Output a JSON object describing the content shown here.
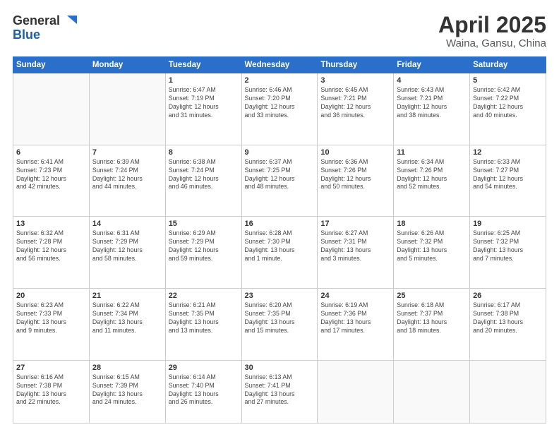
{
  "logo": {
    "general": "General",
    "blue": "Blue"
  },
  "title": {
    "month_year": "April 2025",
    "location": "Waina, Gansu, China"
  },
  "days_of_week": [
    "Sunday",
    "Monday",
    "Tuesday",
    "Wednesday",
    "Thursday",
    "Friday",
    "Saturday"
  ],
  "weeks": [
    [
      {
        "day": "",
        "info": ""
      },
      {
        "day": "",
        "info": ""
      },
      {
        "day": "1",
        "info": "Sunrise: 6:47 AM\nSunset: 7:19 PM\nDaylight: 12 hours\nand 31 minutes."
      },
      {
        "day": "2",
        "info": "Sunrise: 6:46 AM\nSunset: 7:20 PM\nDaylight: 12 hours\nand 33 minutes."
      },
      {
        "day": "3",
        "info": "Sunrise: 6:45 AM\nSunset: 7:21 PM\nDaylight: 12 hours\nand 36 minutes."
      },
      {
        "day": "4",
        "info": "Sunrise: 6:43 AM\nSunset: 7:21 PM\nDaylight: 12 hours\nand 38 minutes."
      },
      {
        "day": "5",
        "info": "Sunrise: 6:42 AM\nSunset: 7:22 PM\nDaylight: 12 hours\nand 40 minutes."
      }
    ],
    [
      {
        "day": "6",
        "info": "Sunrise: 6:41 AM\nSunset: 7:23 PM\nDaylight: 12 hours\nand 42 minutes."
      },
      {
        "day": "7",
        "info": "Sunrise: 6:39 AM\nSunset: 7:24 PM\nDaylight: 12 hours\nand 44 minutes."
      },
      {
        "day": "8",
        "info": "Sunrise: 6:38 AM\nSunset: 7:24 PM\nDaylight: 12 hours\nand 46 minutes."
      },
      {
        "day": "9",
        "info": "Sunrise: 6:37 AM\nSunset: 7:25 PM\nDaylight: 12 hours\nand 48 minutes."
      },
      {
        "day": "10",
        "info": "Sunrise: 6:36 AM\nSunset: 7:26 PM\nDaylight: 12 hours\nand 50 minutes."
      },
      {
        "day": "11",
        "info": "Sunrise: 6:34 AM\nSunset: 7:26 PM\nDaylight: 12 hours\nand 52 minutes."
      },
      {
        "day": "12",
        "info": "Sunrise: 6:33 AM\nSunset: 7:27 PM\nDaylight: 12 hours\nand 54 minutes."
      }
    ],
    [
      {
        "day": "13",
        "info": "Sunrise: 6:32 AM\nSunset: 7:28 PM\nDaylight: 12 hours\nand 56 minutes."
      },
      {
        "day": "14",
        "info": "Sunrise: 6:31 AM\nSunset: 7:29 PM\nDaylight: 12 hours\nand 58 minutes."
      },
      {
        "day": "15",
        "info": "Sunrise: 6:29 AM\nSunset: 7:29 PM\nDaylight: 12 hours\nand 59 minutes."
      },
      {
        "day": "16",
        "info": "Sunrise: 6:28 AM\nSunset: 7:30 PM\nDaylight: 13 hours\nand 1 minute."
      },
      {
        "day": "17",
        "info": "Sunrise: 6:27 AM\nSunset: 7:31 PM\nDaylight: 13 hours\nand 3 minutes."
      },
      {
        "day": "18",
        "info": "Sunrise: 6:26 AM\nSunset: 7:32 PM\nDaylight: 13 hours\nand 5 minutes."
      },
      {
        "day": "19",
        "info": "Sunrise: 6:25 AM\nSunset: 7:32 PM\nDaylight: 13 hours\nand 7 minutes."
      }
    ],
    [
      {
        "day": "20",
        "info": "Sunrise: 6:23 AM\nSunset: 7:33 PM\nDaylight: 13 hours\nand 9 minutes."
      },
      {
        "day": "21",
        "info": "Sunrise: 6:22 AM\nSunset: 7:34 PM\nDaylight: 13 hours\nand 11 minutes."
      },
      {
        "day": "22",
        "info": "Sunrise: 6:21 AM\nSunset: 7:35 PM\nDaylight: 13 hours\nand 13 minutes."
      },
      {
        "day": "23",
        "info": "Sunrise: 6:20 AM\nSunset: 7:35 PM\nDaylight: 13 hours\nand 15 minutes."
      },
      {
        "day": "24",
        "info": "Sunrise: 6:19 AM\nSunset: 7:36 PM\nDaylight: 13 hours\nand 17 minutes."
      },
      {
        "day": "25",
        "info": "Sunrise: 6:18 AM\nSunset: 7:37 PM\nDaylight: 13 hours\nand 18 minutes."
      },
      {
        "day": "26",
        "info": "Sunrise: 6:17 AM\nSunset: 7:38 PM\nDaylight: 13 hours\nand 20 minutes."
      }
    ],
    [
      {
        "day": "27",
        "info": "Sunrise: 6:16 AM\nSunset: 7:38 PM\nDaylight: 13 hours\nand 22 minutes."
      },
      {
        "day": "28",
        "info": "Sunrise: 6:15 AM\nSunset: 7:39 PM\nDaylight: 13 hours\nand 24 minutes."
      },
      {
        "day": "29",
        "info": "Sunrise: 6:14 AM\nSunset: 7:40 PM\nDaylight: 13 hours\nand 26 minutes."
      },
      {
        "day": "30",
        "info": "Sunrise: 6:13 AM\nSunset: 7:41 PM\nDaylight: 13 hours\nand 27 minutes."
      },
      {
        "day": "",
        "info": ""
      },
      {
        "day": "",
        "info": ""
      },
      {
        "day": "",
        "info": ""
      }
    ]
  ]
}
